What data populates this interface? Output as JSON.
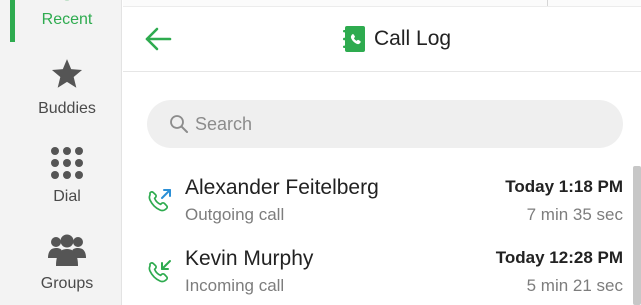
{
  "nav": {
    "items": [
      {
        "label": "Recent",
        "icon": "clock-icon",
        "active": true
      },
      {
        "label": "Buddies",
        "icon": "star-icon",
        "active": false
      },
      {
        "label": "Dial",
        "icon": "dialpad-icon",
        "active": false
      },
      {
        "label": "Groups",
        "icon": "group-icon",
        "active": false
      }
    ]
  },
  "header": {
    "title": "Call Log",
    "back_icon": "back-arrow-icon",
    "title_icon": "call-log-icon"
  },
  "search": {
    "placeholder": "Search",
    "value": ""
  },
  "calls": [
    {
      "name": "Alexander Feitelberg",
      "type": "Outgoing call",
      "time": "Today 1:18 PM",
      "duration": "7 min 35 sec",
      "icon": "outgoing-call-icon"
    },
    {
      "name": "Kevin Murphy",
      "type": "Incoming call",
      "time": "Today 12:28 PM",
      "duration": "5 min 21 sec",
      "icon": "incoming-call-icon"
    }
  ],
  "colors": {
    "accent": "#2eab4f",
    "outgoing_arrow": "#2b8fd6",
    "text_primary": "#222222",
    "text_secondary": "#7d7d7d",
    "nav_background": "#f3f3f3",
    "search_background": "#efefef"
  }
}
